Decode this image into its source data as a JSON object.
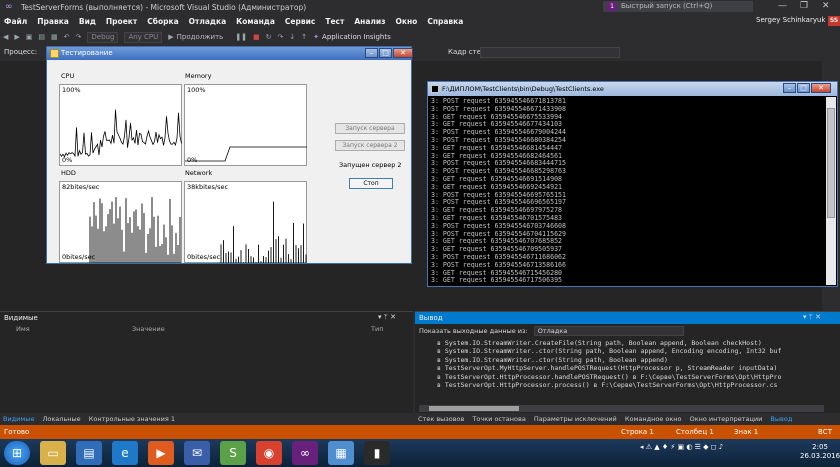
{
  "window": {
    "title": "TestServerForms (выполняется) - Microsoft Visual Studio (Администратор)",
    "quick_launch": "Быстрый запуск (Ctrl+Q)",
    "notif_count": "1"
  },
  "menu": {
    "items": [
      "Файл",
      "Правка",
      "Вид",
      "Проект",
      "Сборка",
      "Отладка",
      "Команда",
      "Сервис",
      "Тест",
      "Анализ",
      "Окно",
      "Справка"
    ],
    "user": "Sergey Schinkaryuk",
    "user_initials": "SS"
  },
  "toolbar": {
    "config": "Debug",
    "platform": "Any CPU",
    "continue_label": "Продолжить",
    "app_insights": "Application Insights",
    "process_label": "Процесс:",
    "stack_label": "Кадр стека:"
  },
  "form": {
    "title": "Тестирование",
    "cpu_label": "CPU",
    "memory_label": "Memory",
    "hdd_label": "HDD",
    "network_label": "Network",
    "cpu_top": "100%",
    "cpu_bottom": "0%",
    "mem_top": "100%",
    "mem_bottom": "0%",
    "hdd_top": "82bites/sec",
    "hdd_bottom": "0bites/sec",
    "net_top": "38kbites/sec",
    "net_bottom": "0bites/sec",
    "btn_start": "Запуск сервера",
    "btn_start2": "Запуск сервера 2",
    "status_label": "Запущен сервер 2",
    "btn_stop": "Стоп"
  },
  "console": {
    "title": "F:\\ДИПЛОМ\\TestClients\\bin\\Debug\\TestClients.exe",
    "lines": [
      "3: POST request 635945546671813781",
      "3: POST request 635945546671433908",
      "3: GET request 635945546675533994",
      "3: GET request 635945546677434103",
      "3: POST request 635945546679004244",
      "3: POST request 635945546680384254",
      "3: GET request 635945546681454447",
      "3: GET request 635945546682464561",
      "3: POST request 635945546683444715",
      "3: POST request 635945546685298763",
      "3: GET request 635945546691514908",
      "3: GET request 635945546692454921",
      "3: POST request 635945546695765151",
      "3: POST request 635945546696565197",
      "3: GET request 635945546697975278",
      "3: GET request 635945546701575483",
      "3: POST request 635945546703746608",
      "3: POST request 635945546704115629",
      "3: GET request 635945546707685852",
      "3: GET request 635945546709505937",
      "3: POST request 635945546711686062",
      "3: POST request 635945546713586166",
      "3: GET request 635945546715456280",
      "3: GET request 635945546717506395",
      "3: POST request 635945546719736522"
    ]
  },
  "locals": {
    "title": "Видимые",
    "col_name": "Имя",
    "col_value": "Значение",
    "col_type": "Тип",
    "pin": "▾ ᛘ ✕"
  },
  "output": {
    "title": "Вывод",
    "show_from": "Показать выходные данные из:",
    "source": "Отладка",
    "pin": "▾ ᛘ ✕",
    "lines": [
      "в System.IO.StreamWriter.CreateFile(String path, Boolean append, Boolean checkHost)",
      "в System.IO.StreamWriter..ctor(String path, Boolean append, Encoding encoding, Int32 buf",
      "в System.IO.StreamWriter..ctor(String path, Boolean append)",
      "в TestServerOpt.MyHttpServer.handlePOSTRequest(HttpProcessor p, StreamReader inputData)",
      "в TestServerOpt.HttpProcessor.handlePOSTRequest() в F:\\Серве\\TestServerForms\\Opt\\HttpPro",
      "в TestServerOpt.HttpProcessor.process() в F:\\Серве\\TestServerForms\\Opt\\HttpProcessor.cs"
    ]
  },
  "tabs_left": [
    "Видимые",
    "Локальные",
    "Контрольные значения 1"
  ],
  "tabs_right": [
    "Стек вызовов",
    "Точки останова",
    "Параметры исключений",
    "Командное окно",
    "Окно интерпретации",
    "Вывод"
  ],
  "status": {
    "ready": "Готово",
    "line": "Строка 1",
    "col": "Столбец 1",
    "char": "Знак 1",
    "ins": "ВСТ"
  },
  "taskbar": {
    "time": "2:05",
    "date": "26.03.2016"
  }
}
